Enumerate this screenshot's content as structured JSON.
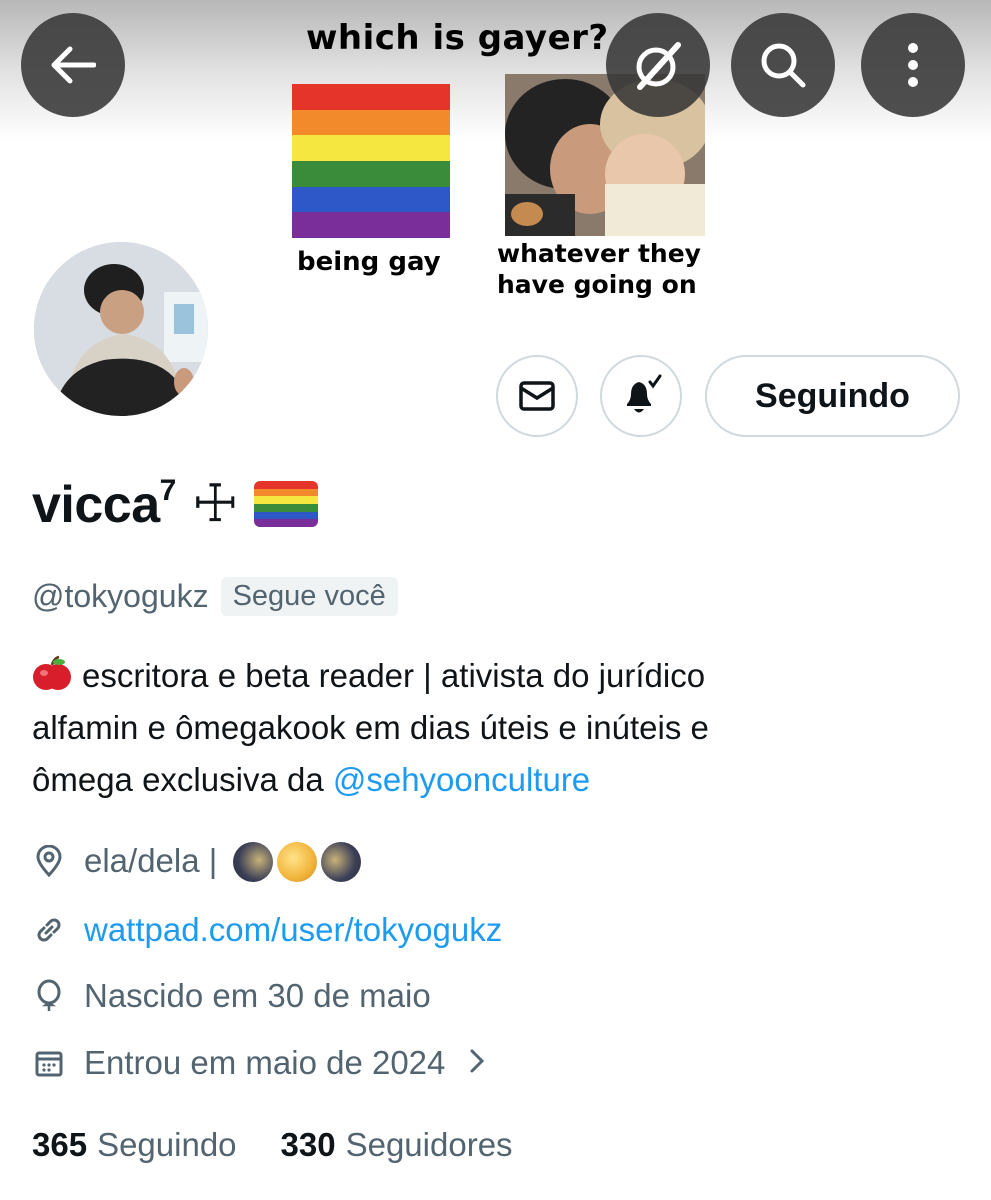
{
  "banner": {
    "meme_title": "which is gayer?",
    "left_caption": "being gay",
    "right_caption_line1": "whatever they",
    "right_caption_line2": "have going on",
    "flag_colors": [
      "#e40303",
      "#ff8c00",
      "#ffed00",
      "#008026",
      "#004dff",
      "#750787"
    ]
  },
  "top_bar": {
    "back_icon": "arrow-left-icon",
    "grok_icon": "grok-icon",
    "search_icon": "search-icon",
    "more_icon": "more-vertical-icon"
  },
  "actions": {
    "message_icon": "envelope-icon",
    "notify_icon": "bell-check-icon",
    "follow_label": "Seguindo"
  },
  "profile": {
    "display_name": "vicca",
    "name_superscript": "7",
    "name_symbol": "☩",
    "handle": "@tokyogukz",
    "follows_you": "Segue você",
    "bio_line1": "escritora e beta reader | ativista do jurídico",
    "bio_line2": "alfamin e ômegakook em dias úteis e inúteis e",
    "bio_line3_text": "ômega exclusiva da ",
    "bio_line3_mention": "@sehyoonculture",
    "location": "ela/dela  |",
    "website": "wattpad.com/user/tokyogukz",
    "birthday": "Nascido em 30 de maio",
    "joined": "Entrou em maio de 2024"
  },
  "stats": {
    "following_count": "365",
    "following_label": "Seguindo",
    "followers_count": "330",
    "followers_label": "Seguidores"
  },
  "colors": {
    "accent": "#1d9bf0",
    "secondary_text": "#536471",
    "border": "#cfd9de"
  }
}
